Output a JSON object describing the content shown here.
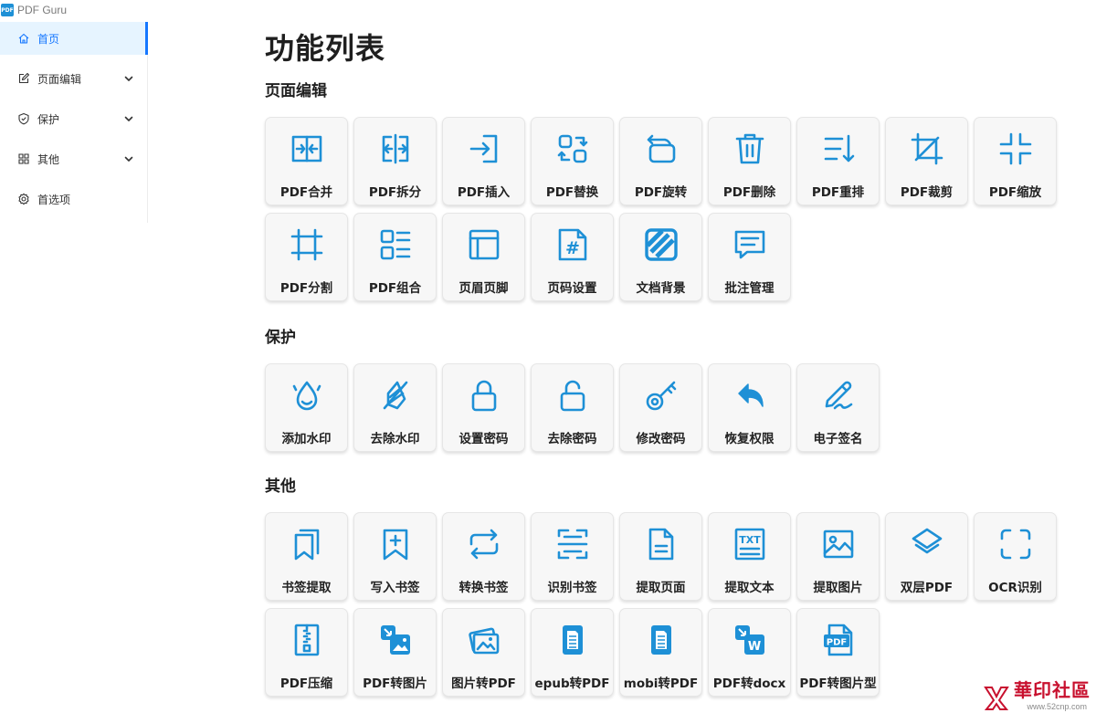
{
  "app": {
    "title": "PDF Guru",
    "logo_text": "PDF"
  },
  "sidebar": {
    "items": [
      {
        "label": "首页",
        "icon": "home-icon",
        "active": true
      },
      {
        "label": "页面编辑",
        "icon": "edit-icon",
        "expandable": true
      },
      {
        "label": "保护",
        "icon": "shield-icon",
        "expandable": true
      },
      {
        "label": "其他",
        "icon": "apps-icon",
        "expandable": true
      },
      {
        "label": "首选项",
        "icon": "gear-icon"
      }
    ]
  },
  "main": {
    "title": "功能列表",
    "sections": [
      {
        "title": "页面编辑",
        "items": [
          {
            "label": "PDF合并",
            "icon": "merge-icon"
          },
          {
            "label": "PDF拆分",
            "icon": "split-icon"
          },
          {
            "label": "PDF插入",
            "icon": "insert-icon"
          },
          {
            "label": "PDF替换",
            "icon": "replace-icon"
          },
          {
            "label": "PDF旋转",
            "icon": "rotate-icon"
          },
          {
            "label": "PDF删除",
            "icon": "trash-icon"
          },
          {
            "label": "PDF重排",
            "icon": "reorder-icon"
          },
          {
            "label": "PDF裁剪",
            "icon": "crop-icon"
          },
          {
            "label": "PDF缩放",
            "icon": "shrink-icon"
          },
          {
            "label": "PDF分割",
            "icon": "frame-icon"
          },
          {
            "label": "PDF组合",
            "icon": "layout-icon"
          },
          {
            "label": "页眉页脚",
            "icon": "header-footer-icon"
          },
          {
            "label": "页码设置",
            "icon": "page-number-icon"
          },
          {
            "label": "文档背景",
            "icon": "background-icon"
          },
          {
            "label": "批注管理",
            "icon": "comment-icon"
          }
        ]
      },
      {
        "title": "保护",
        "items": [
          {
            "label": "添加水印",
            "icon": "drop-icon"
          },
          {
            "label": "去除水印",
            "icon": "drop-off-icon"
          },
          {
            "label": "设置密码",
            "icon": "lock-icon"
          },
          {
            "label": "去除密码",
            "icon": "unlock-icon"
          },
          {
            "label": "修改密码",
            "icon": "key-icon"
          },
          {
            "label": "恢复权限",
            "icon": "undo-icon"
          },
          {
            "label": "电子签名",
            "icon": "signature-icon"
          }
        ]
      },
      {
        "title": "其他",
        "items": [
          {
            "label": "书签提取",
            "icon": "bookmarks-icon"
          },
          {
            "label": "写入书签",
            "icon": "bookmark-add-icon"
          },
          {
            "label": "转换书签",
            "icon": "convert-icon"
          },
          {
            "label": "识别书签",
            "icon": "scan-icon"
          },
          {
            "label": "提取页面",
            "icon": "document-icon"
          },
          {
            "label": "提取文本",
            "icon": "txt-icon"
          },
          {
            "label": "提取图片",
            "icon": "image-icon"
          },
          {
            "label": "双层PDF",
            "icon": "layers-icon"
          },
          {
            "label": "OCR识别",
            "icon": "ocr-icon"
          },
          {
            "label": "PDF压缩",
            "icon": "zip-icon"
          },
          {
            "label": "PDF转图片",
            "icon": "pdf-to-image-icon"
          },
          {
            "label": "图片转PDF",
            "icon": "images-icon"
          },
          {
            "label": "epub转PDF",
            "icon": "epub-icon"
          },
          {
            "label": "mobi转PDF",
            "icon": "mobi-icon"
          },
          {
            "label": "PDF转docx",
            "icon": "pdf-to-word-icon"
          },
          {
            "label": "PDF转图片型",
            "icon": "pdf-file-icon"
          }
        ]
      }
    ]
  },
  "watermark": {
    "text": "華印社區",
    "url": "www.52cnp.com"
  },
  "colors": {
    "accent": "#1677ff",
    "icon": "#1E90D6",
    "active_bg": "#E6F4FF"
  }
}
